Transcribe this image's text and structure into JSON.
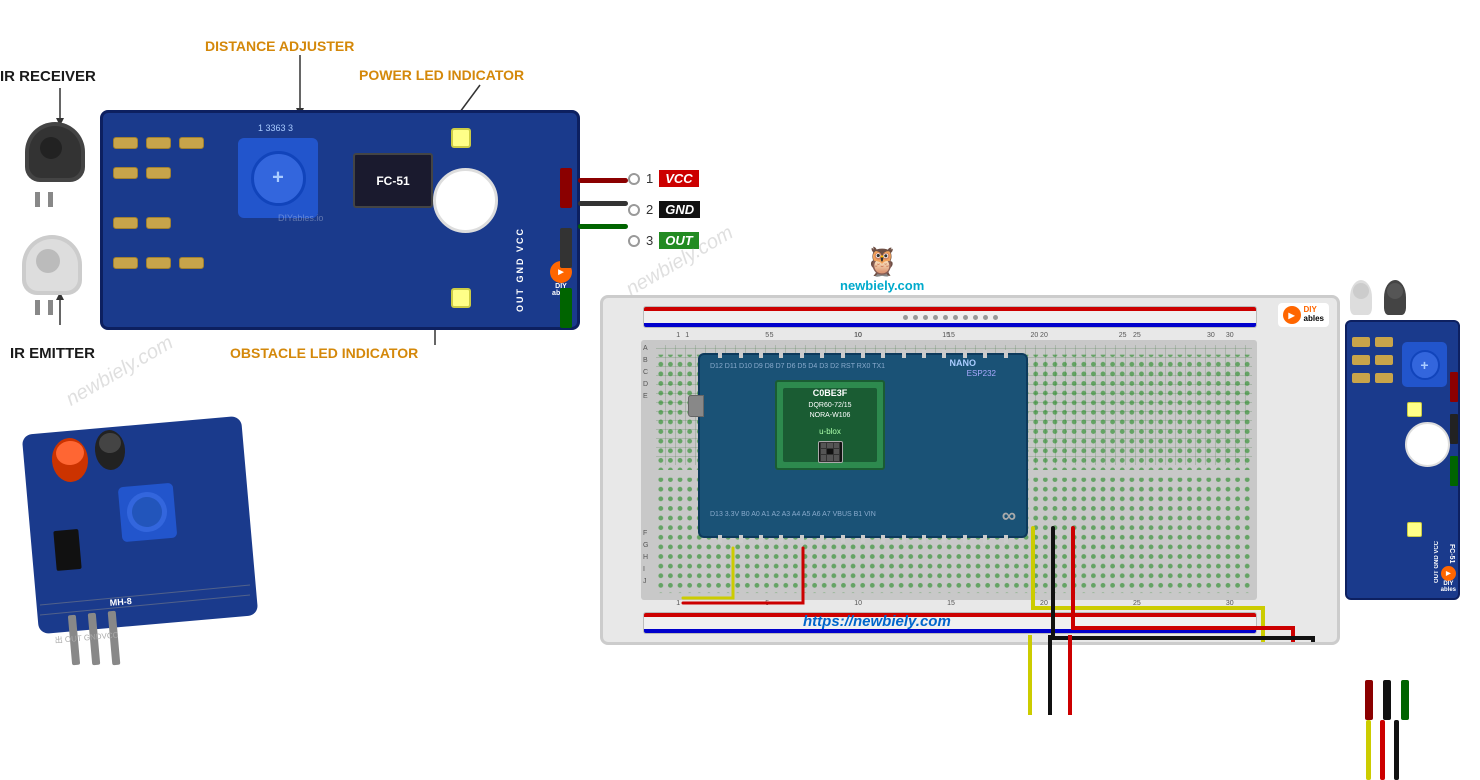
{
  "labels": {
    "ir_receiver": "IR RECEIVER",
    "ir_emitter": "IR EMITTER",
    "distance_adjuster": "DISTANCE ADJUSTER",
    "power_led": "POWER LED INDICATOR",
    "obstacle_led": "OBSTACLE LED INDICATOR",
    "fc51": "FC-51",
    "brand": "DIY\nables",
    "brand2": "DIYables.io",
    "website": "newbiely.com",
    "url": "https://newbiely.com",
    "pin1": "1",
    "pin2": "2",
    "pin3": "3",
    "vcc": "VCC",
    "gnd": "GND",
    "out": "OUT",
    "out_gnd_vcc": "OUT GND VCC",
    "nano_text": "NANO",
    "esp32_text": "ESP32",
    "ublox": "u-blox",
    "arduino_symbol": "∞"
  },
  "colors": {
    "board_blue": "#1a3a8c",
    "wire_red": "#cc0000",
    "wire_black": "#111111",
    "wire_green": "#006400",
    "wire_yellow": "#cccc00",
    "label_orange": "#d4880a",
    "breadboard_bg": "#e0e0e0",
    "newbiely_teal": "#00aacc"
  }
}
